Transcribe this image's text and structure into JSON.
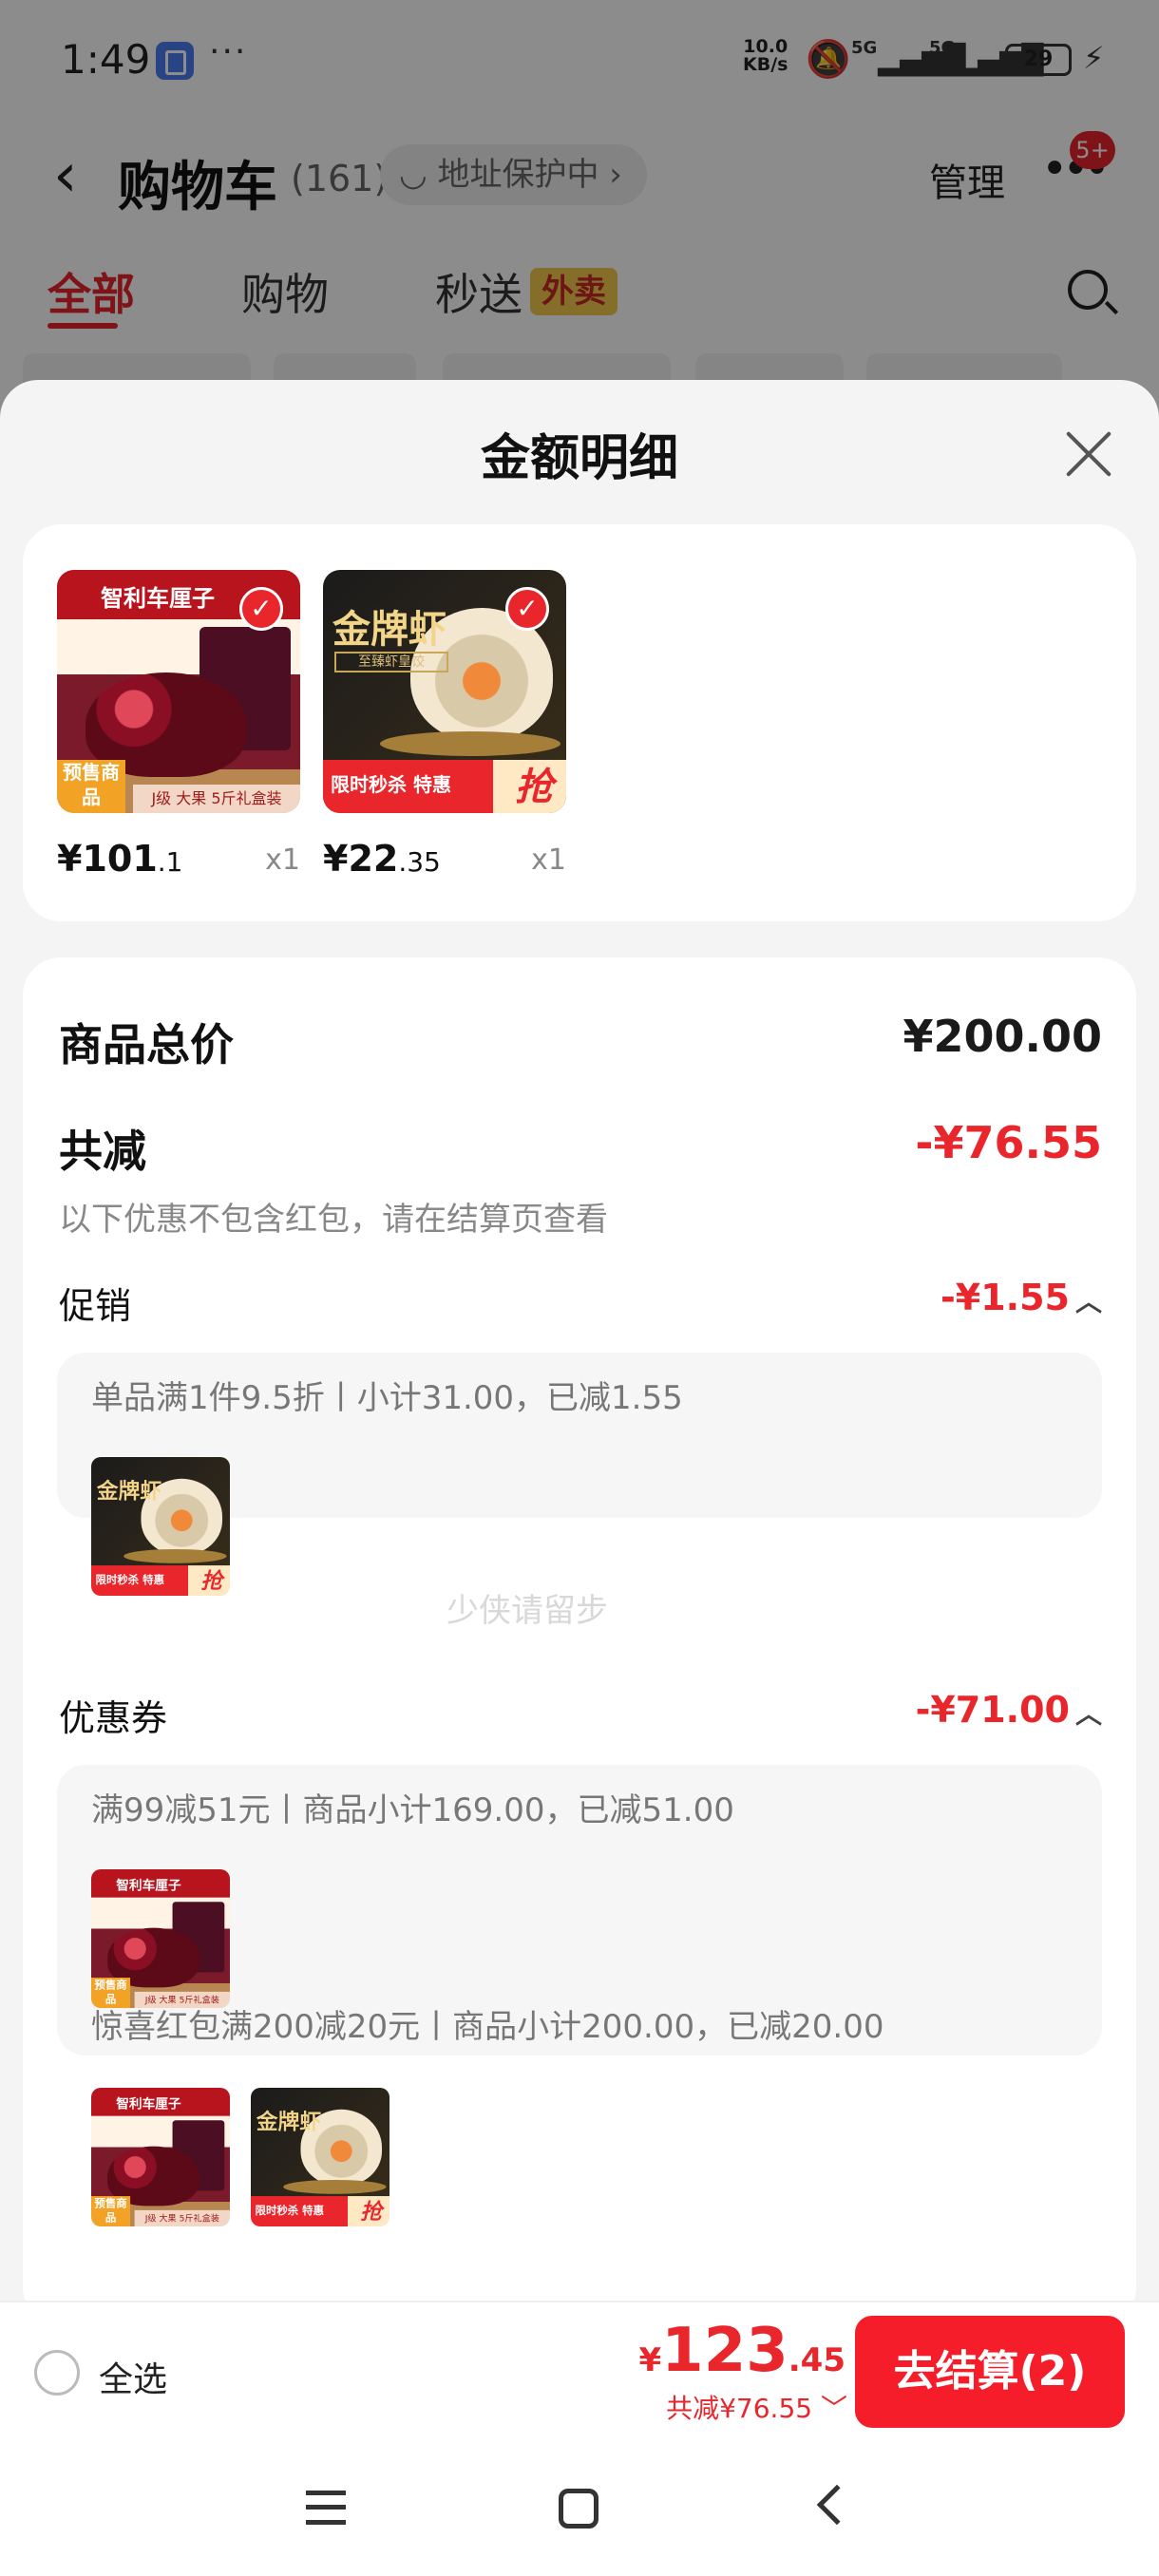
{
  "status_bar": {
    "time": "1:49",
    "more": "···",
    "net_speed_value": "10.0",
    "net_speed_unit": "KB/s",
    "signal1": "5G",
    "signal2": "5G",
    "battery": "29"
  },
  "header": {
    "back_icon": "chevron-left-icon",
    "title": "购物车",
    "count": "(161)",
    "address": "地址保护中",
    "manage": "管理",
    "badge": "5+"
  },
  "tabs": [
    {
      "label": "全部",
      "active": true
    },
    {
      "label": "购物",
      "active": false
    },
    {
      "label": "秒送",
      "active": false,
      "tag": "外卖"
    }
  ],
  "sheet": {
    "title": "金额明细",
    "products": [
      {
        "name": "cherry",
        "price_int": "¥101",
        "price_dec": ".1",
        "qty": "x1",
        "img_text": {
          "top": "智利车厘子",
          "tag": "预售商品",
          "foot": "J级 大果 5斤礼盒装"
        }
      },
      {
        "name": "shrimp-dumpling",
        "price_int": "¥22",
        "price_dec": ".35",
        "qty": "x1",
        "img_text": {
          "title": "金牌虾",
          "sub": "至臻虾皇饺",
          "strip": "限时秒杀 特惠",
          "badge": "抢"
        }
      }
    ],
    "total_label": "商品总价",
    "total_value": "¥200.00",
    "reduce_label": "共减",
    "reduce_value": "-¥76.55",
    "reduce_note": "以下优惠不包含红包，请在结算页查看",
    "promo": {
      "label": "促销",
      "value": "-¥1.55",
      "line": "单品满1件9.5折丨小计31.00，已减1.55"
    },
    "coupon": {
      "label": "优惠券",
      "value": "-¥71.00",
      "line1": "满99减51元丨商品小计169.00，已减51.00",
      "line2": "惊喜红包满200减20元丨商品小计200.00，已减20.00"
    },
    "watermark": "少侠请留步"
  },
  "checkout": {
    "select_all": "全选",
    "currency": "¥",
    "total_int": "123",
    "total_dec": ".45",
    "saved": "共减¥76.55",
    "pay_button": "去结算(2)"
  },
  "colors": {
    "accent_red": "#e8262c",
    "pay_button": "#f51d2a"
  }
}
